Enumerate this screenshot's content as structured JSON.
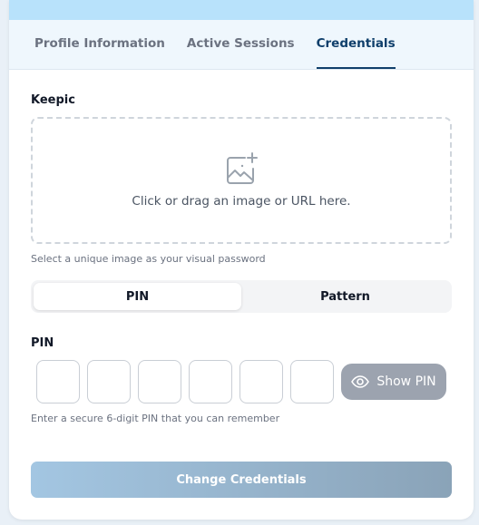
{
  "tabs": [
    {
      "label": "Profile Information"
    },
    {
      "label": "Active Sessions"
    },
    {
      "label": "Credentials"
    }
  ],
  "active_tab": "Credentials",
  "keepic": {
    "label": "Keepic",
    "dropzone_text": "Click or drag an image or URL here.",
    "hint": "Select a unique image as your visual password"
  },
  "mode_toggle": {
    "options": [
      "PIN",
      "Pattern"
    ],
    "selected": "PIN"
  },
  "pin": {
    "label": "PIN",
    "digits": [
      "",
      "",
      "",
      "",
      "",
      ""
    ],
    "show_label": "Show PIN",
    "hint": "Enter a secure 6-digit PIN that you can remember"
  },
  "submit": {
    "label": "Change Credentials"
  },
  "colors": {
    "accent": "#0f3f6b",
    "topbar": "#b8e2fb",
    "button_start": "#a3c6e2",
    "button_end": "#8aa3b8",
    "show_pin_bg": "#9ca3af"
  }
}
